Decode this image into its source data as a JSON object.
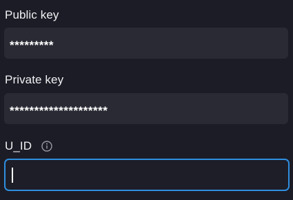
{
  "public_key": {
    "label": "Public key",
    "value": "*********"
  },
  "private_key": {
    "label": "Private key",
    "value": "********************"
  },
  "u_id": {
    "label": "U_ID",
    "value": "",
    "info_icon": "info-circle-icon"
  },
  "colors": {
    "background": "#1c1c26",
    "field_background": "#2a2a34",
    "focus_border": "#2f8fe0",
    "text": "#ffffff"
  }
}
